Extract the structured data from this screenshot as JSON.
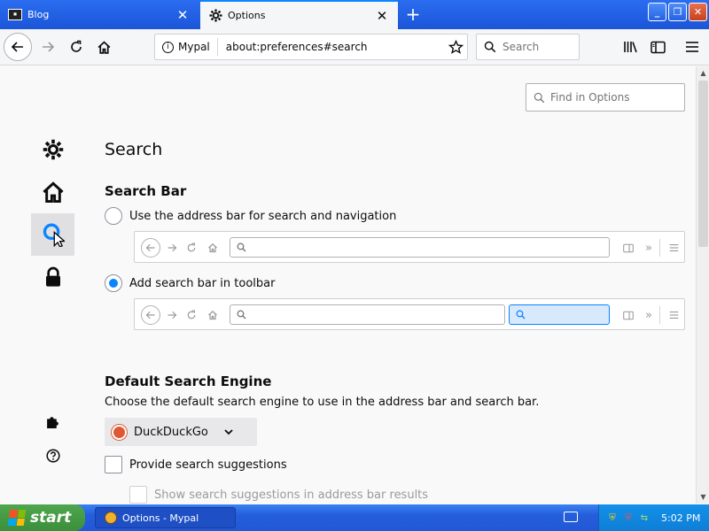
{
  "tabs": [
    {
      "title": "Blog",
      "icon": "blog-favicon"
    },
    {
      "title": "Options",
      "icon": "gear-icon"
    }
  ],
  "navbar": {
    "identity_label": "Mypal",
    "url": "about:preferences#search",
    "search_placeholder": "Search"
  },
  "page": {
    "find_placeholder": "Find in Options",
    "title": "Search",
    "search_bar": {
      "heading": "Search Bar",
      "option_address": "Use the address bar for search and navigation",
      "option_toolbar": "Add search bar in toolbar",
      "selected": "toolbar"
    },
    "default_engine": {
      "heading": "Default Search Engine",
      "description": "Choose the default search engine to use in the address bar and search bar.",
      "engine": "DuckDuckGo",
      "provide_suggestions": "Provide search suggestions",
      "show_in_address": "Show search suggestions in address bar results"
    }
  },
  "taskbar": {
    "start_label": "start",
    "task_label": "Options - Mypal",
    "clock": "5:02 PM"
  },
  "colors": {
    "accent": "#0a84ff",
    "titlebar": "#1b55d8",
    "taskbar": "#245edb",
    "start": "#3c8f3c"
  }
}
